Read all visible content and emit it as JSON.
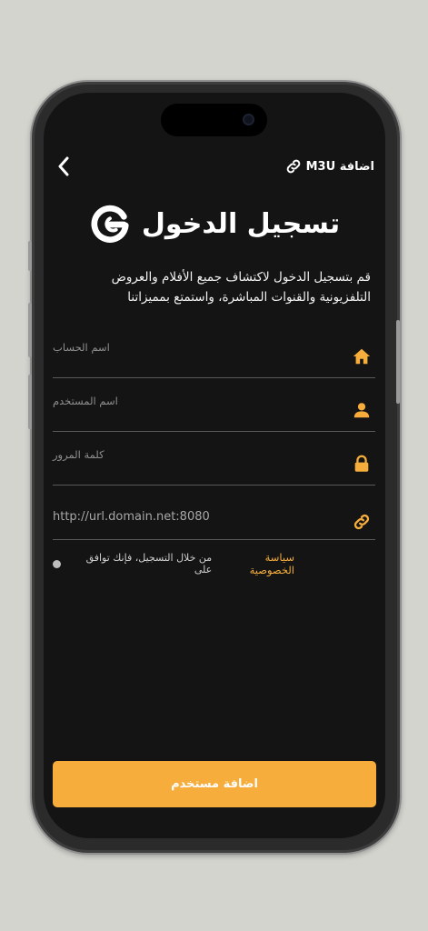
{
  "header": {
    "m3u_label": "M3U اضافة",
    "back_icon": "chevron-left-icon",
    "link_icon": "link-icon"
  },
  "logo": {
    "title": "تسجيل الدخول",
    "icon": "g-logo-icon"
  },
  "intro_text": "قم بتسجيل الدخول لاكتشاف جميع الأفلام والعروض التلفزيونية والقنوات المباشرة، واستمتع بمميزاتنا",
  "fields": {
    "account_name": {
      "placeholder": "اسم الحساب",
      "icon": "home-icon"
    },
    "username": {
      "placeholder": "اسم المستخدم",
      "icon": "user-icon"
    },
    "password": {
      "placeholder": "كلمة المرور",
      "icon": "lock-icon"
    },
    "url": {
      "value": "http://url.domain.net:8080",
      "icon": "link-icon"
    }
  },
  "policy": {
    "text": "من خلال التسجيل، فإنك توافق على",
    "link": "سياسة الخصوصية"
  },
  "submit_label": "اضافة مستخدم",
  "colors": {
    "accent": "#f6ad3c",
    "screen_bg": "#141414",
    "page_bg": "#d4d4cf"
  }
}
